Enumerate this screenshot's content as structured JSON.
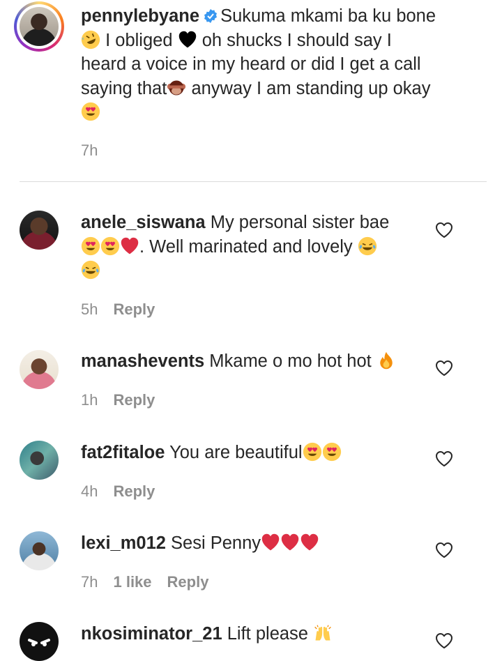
{
  "caption": {
    "username": "pennylebyane",
    "line1": "Sukuma mkami ba ku bone",
    "line2a": "I obliged",
    "line2b": "oh shucks I should say I",
    "line3": "heard a voice in my heard or did I get a call",
    "line4a": "saying that",
    "line4b": "anyway I am standing up okay",
    "time": "7h"
  },
  "comments": [
    {
      "username": "anele_siswana",
      "line1": "My personal sister bae",
      "line2": ". Well marinated and lovely",
      "time": "5h",
      "reply": "Reply"
    },
    {
      "username": "manashevents",
      "line1": "Mkame o mo hot hot",
      "time": "1h",
      "reply": "Reply"
    },
    {
      "username": "fat2fitaloe",
      "line1": "You are beautiful",
      "time": "4h",
      "reply": "Reply"
    },
    {
      "username": "lexi_m012",
      "line1": "Sesi Penny",
      "time": "7h",
      "likes": "1 like",
      "reply": "Reply"
    },
    {
      "username": "nkosiminator_21",
      "line1": "Lift please"
    }
  ],
  "colors": {
    "text": "#262626",
    "meta": "#8e8e8e",
    "verified": "#3897f0",
    "divider": "#dbdbdb"
  },
  "icons": {
    "verified": "verified-badge-icon",
    "like": "heart-outline-icon"
  }
}
